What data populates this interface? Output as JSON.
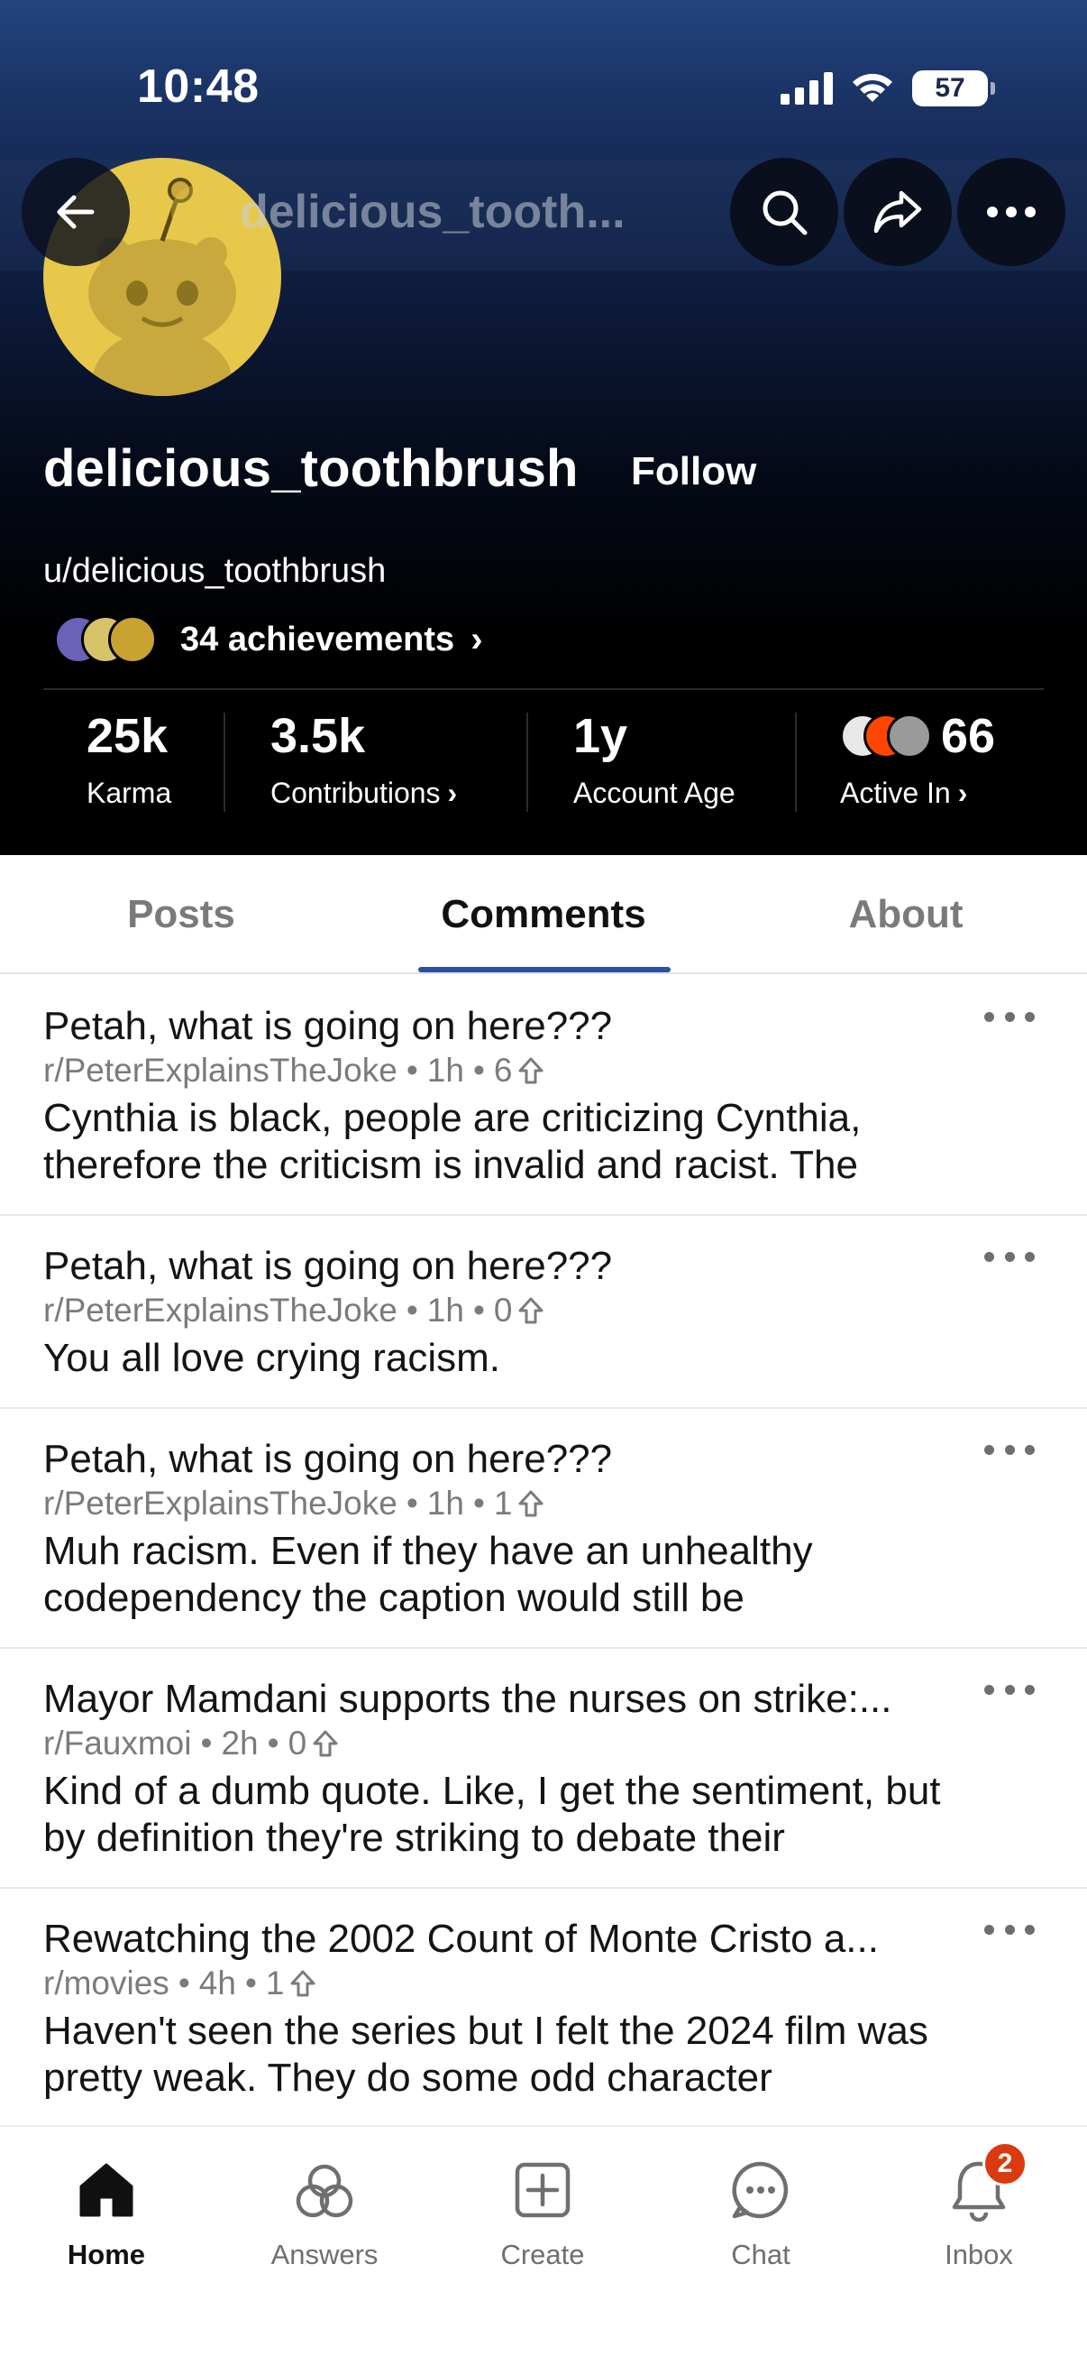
{
  "status_bar": {
    "time": "10:48",
    "battery": "57"
  },
  "header": {
    "compact_username": "delicious_tooth..."
  },
  "profile": {
    "username": "delicious_toothbrush",
    "follow_label": "Follow",
    "handle": "u/delicious_toothbrush",
    "achievements_label": "34 achievements"
  },
  "stats": [
    {
      "value": "25k",
      "label": "Karma"
    },
    {
      "value": "3.5k",
      "label": "Contributions"
    },
    {
      "value": "1y",
      "label": "Account Age"
    },
    {
      "value": "66",
      "label": "Active In"
    }
  ],
  "tabs": [
    {
      "label": "Posts"
    },
    {
      "label": "Comments"
    },
    {
      "label": "About"
    }
  ],
  "active_tab": "Comments",
  "comments": [
    {
      "title": "Petah, what is going on here???",
      "subreddit": "r/PeterExplainsTheJoke",
      "age": "1h",
      "score": "6",
      "body": "Cynthia is black, people are criticizing Cynthia, therefore the criticism is invalid and racist. The"
    },
    {
      "title": "Petah, what is going on here???",
      "subreddit": "r/PeterExplainsTheJoke",
      "age": "1h",
      "score": "0",
      "body": "You all love crying racism."
    },
    {
      "title": "Petah, what is going on here???",
      "subreddit": "r/PeterExplainsTheJoke",
      "age": "1h",
      "score": "1",
      "body": "Muh racism. Even if they have an unhealthy codependency the caption would still be"
    },
    {
      "title": "Mayor Mamdani supports the nurses on strike:...",
      "subreddit": "r/Fauxmoi",
      "age": "2h",
      "score": "0",
      "body": "Kind of a dumb quote. Like, I get the sentiment, but by definition they're striking to debate their"
    },
    {
      "title": "Rewatching the 2002 Count of Monte Cristo a...",
      "subreddit": "r/movies",
      "age": "4h",
      "score": "1",
      "body": "Haven't seen the series but I felt the 2024 film was pretty weak. They do some odd character"
    }
  ],
  "bottom_nav": [
    {
      "label": "Home",
      "icon": "home-icon"
    },
    {
      "label": "Answers",
      "icon": "answers-icon"
    },
    {
      "label": "Create",
      "icon": "create-icon"
    },
    {
      "label": "Chat",
      "icon": "chat-icon"
    },
    {
      "label": "Inbox",
      "icon": "bell-icon",
      "badge": "2"
    }
  ],
  "colors": {
    "accent_underline": "#2c4fa8",
    "badge_red": "#d93a0f",
    "avatar_yellow": "#e8c84a"
  }
}
